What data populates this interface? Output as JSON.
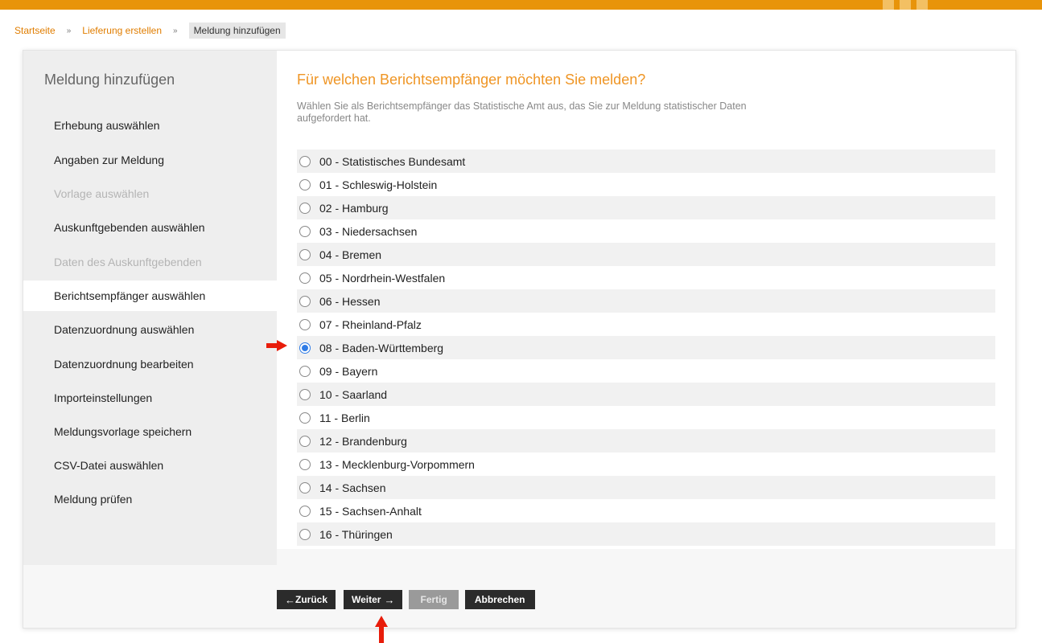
{
  "breadcrumb": {
    "items": [
      "Startseite",
      "Lieferung erstellen"
    ],
    "separator": "»",
    "current": "Meldung hinzufügen"
  },
  "sidebar": {
    "title": "Meldung hinzufügen",
    "items": [
      {
        "label": "Erhebung auswählen",
        "state": "enabled"
      },
      {
        "label": "Angaben zur Meldung",
        "state": "enabled"
      },
      {
        "label": "Vorlage auswählen",
        "state": "disabled"
      },
      {
        "label": "Auskunftgebenden auswählen",
        "state": "enabled"
      },
      {
        "label": "Daten des Auskunftgebenden",
        "state": "disabled"
      },
      {
        "label": "Berichtsempfänger auswählen",
        "state": "active"
      },
      {
        "label": "Datenzuordnung auswählen",
        "state": "enabled"
      },
      {
        "label": "Datenzuordnung bearbeiten",
        "state": "enabled"
      },
      {
        "label": "Importeinstellungen",
        "state": "enabled"
      },
      {
        "label": "Meldungsvorlage speichern",
        "state": "enabled"
      },
      {
        "label": "CSV-Datei auswählen",
        "state": "enabled"
      },
      {
        "label": "Meldung prüfen",
        "state": "enabled"
      }
    ]
  },
  "main": {
    "heading": "Für welchen Berichtsempfänger möchten Sie melden?",
    "description": "Wählen Sie als Berichtsempfänger das Statistische Amt aus, das Sie zur Meldung statistischer Daten aufgefordert hat.",
    "options": [
      {
        "label": "00 - Statistisches Bundesamt",
        "checked": false
      },
      {
        "label": "01 - Schleswig-Holstein",
        "checked": false
      },
      {
        "label": "02 - Hamburg",
        "checked": false
      },
      {
        "label": "03 - Niedersachsen",
        "checked": false
      },
      {
        "label": "04 - Bremen",
        "checked": false
      },
      {
        "label": "05 - Nordrhein-Westfalen",
        "checked": false
      },
      {
        "label": "06 - Hessen",
        "checked": false
      },
      {
        "label": "07 - Rheinland-Pfalz",
        "checked": false
      },
      {
        "label": "08 - Baden-Württemberg",
        "checked": true
      },
      {
        "label": "09 - Bayern",
        "checked": false
      },
      {
        "label": "10 - Saarland",
        "checked": false
      },
      {
        "label": "11 - Berlin",
        "checked": false
      },
      {
        "label": "12 - Brandenburg",
        "checked": false
      },
      {
        "label": "13 - Mecklenburg-Vorpommern",
        "checked": false
      },
      {
        "label": "14 - Sachsen",
        "checked": false
      },
      {
        "label": "15 - Sachsen-Anhalt",
        "checked": false
      },
      {
        "label": "16 - Thüringen",
        "checked": false
      }
    ]
  },
  "buttons": {
    "back": {
      "label": "Zurück",
      "icon": "arrow-left-icon"
    },
    "next": {
      "label": "Weiter",
      "icon": "arrow-right-icon"
    },
    "finish": {
      "label": "Fertig",
      "disabled": true
    },
    "cancel": {
      "label": "Abbrechen"
    }
  },
  "colors": {
    "accent": "#e8940a",
    "heading": "#ef9524",
    "link": "#e07d00",
    "radio_selected": "#2f7ce6",
    "button": "#2b2b2b",
    "annotation_arrow": "#e81c0a"
  }
}
